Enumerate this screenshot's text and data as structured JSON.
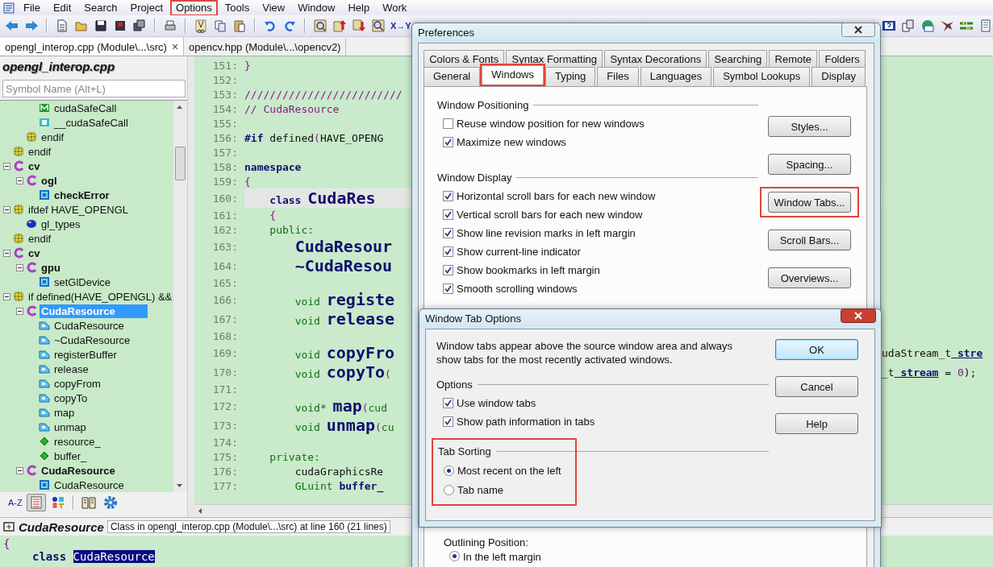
{
  "menu_bar": {
    "items": [
      {
        "label": "File",
        "highlighted": false
      },
      {
        "label": "Edit",
        "highlighted": false
      },
      {
        "label": "Search",
        "highlighted": false
      },
      {
        "label": "Project",
        "highlighted": false
      },
      {
        "label": "Options",
        "highlighted": true
      },
      {
        "label": "Tools",
        "highlighted": false
      },
      {
        "label": "View",
        "highlighted": false
      },
      {
        "label": "Window",
        "highlighted": false
      },
      {
        "label": "Help",
        "highlighted": false
      },
      {
        "label": "Work",
        "highlighted": false
      }
    ]
  },
  "toolbar": {
    "replace_label": "X→Y"
  },
  "file_tabs": [
    {
      "label": "opengl_interop.cpp (Module\\...\\src)",
      "selected": true,
      "close": "×"
    },
    {
      "label": "opencv.hpp (Module\\...\\opencv2)",
      "selected": false
    }
  ],
  "symbol_panel": {
    "title": "opengl_interop.cpp",
    "search": {
      "placeholder": "Symbol Name (Alt+L)"
    },
    "tree": [
      {
        "children": [
          {
            "children": [
              {
                "label": "cudaSafeCall",
                "kind": "macro",
                "bold": false,
                "selected": false
              },
              {
                "label": "__cudaSafeCall",
                "kind": "function-def",
                "bold": false,
                "selected": false
              }
            ]
          },
          {
            "label": "endif",
            "kind": "preprocessor",
            "bold": false,
            "selected": false
          }
        ]
      },
      {
        "label": "endif",
        "kind": "preprocessor",
        "bold": false,
        "selected": false
      },
      {
        "label": "cv",
        "kind": "namespace",
        "bold": true,
        "selected": false,
        "expanded": true,
        "children": [
          {
            "label": "ogl",
            "kind": "namespace",
            "bold": true,
            "selected": false,
            "expanded": true,
            "children": [
              {
                "label": "checkError",
                "kind": "function",
                "bold": true,
                "selected": false
              }
            ]
          }
        ]
      },
      {
        "label": "ifdef HAVE_OPENGL",
        "kind": "preprocessor",
        "bold": false,
        "selected": false,
        "expanded": true,
        "children": [
          {
            "label": "gl_types",
            "kind": "typedef",
            "bold": false,
            "selected": false
          }
        ]
      },
      {
        "label": "endif",
        "kind": "preprocessor",
        "bold": false,
        "selected": false
      },
      {
        "label": "cv",
        "kind": "namespace",
        "bold": true,
        "selected": false,
        "expanded": true,
        "children": [
          {
            "label": "gpu",
            "kind": "namespace",
            "bold": true,
            "selected": false,
            "expanded": true,
            "children": [
              {
                "label": "setGlDevice",
                "kind": "function",
                "bold": false,
                "selected": false
              }
            ]
          }
        ]
      },
      {
        "label": "if defined(HAVE_OPENGL) &&",
        "kind": "preprocessor",
        "bold": false,
        "selected": false,
        "expanded": true,
        "children": [
          {
            "label": "CudaResource",
            "kind": "namespace",
            "bold": true,
            "selected": true,
            "expanded": true,
            "children": [
              {
                "label": "CudaResource",
                "kind": "method",
                "bold": false,
                "selected": false
              },
              {
                "label": "~CudaResource",
                "kind": "method",
                "bold": false,
                "selected": false
              },
              {
                "label": "registerBuffer",
                "kind": "method",
                "bold": false,
                "selected": false
              },
              {
                "label": "release",
                "kind": "method",
                "bold": false,
                "selected": false
              },
              {
                "label": "copyFrom",
                "kind": "method",
                "bold": false,
                "selected": false
              },
              {
                "label": "copyTo",
                "kind": "method",
                "bold": false,
                "selected": false
              },
              {
                "label": "map",
                "kind": "method",
                "bold": false,
                "selected": false
              },
              {
                "label": "unmap",
                "kind": "method",
                "bold": false,
                "selected": false
              },
              {
                "label": "resource_",
                "kind": "field",
                "bold": false,
                "selected": false
              },
              {
                "label": "buffer_",
                "kind": "field",
                "bold": false,
                "selected": false
              }
            ]
          },
          {
            "label": "CudaResource",
            "kind": "namespace",
            "bold": true,
            "selected": false,
            "expanded": true,
            "children": [
              {
                "label": "CudaResource",
                "kind": "function",
                "bold": false,
                "selected": false
              }
            ]
          }
        ]
      }
    ],
    "view_buttons": [
      {
        "kind": "alpha",
        "label": "A-Z",
        "selected": false
      },
      {
        "kind": "outline",
        "selected": true
      },
      {
        "kind": "symbol-types",
        "selected": false
      }
    ]
  },
  "editor": {
    "lines": [
      {
        "number": "151:",
        "current": false,
        "tokens": [
          {
            "text": "}",
            "kind": "paren"
          }
        ]
      },
      {
        "number": "152:",
        "current": false
      },
      {
        "number": "153:",
        "current": false,
        "tokens": [
          {
            "text": "/////////////////////////",
            "kind": "comment"
          }
        ]
      },
      {
        "number": "154:",
        "current": false,
        "tokens": [
          {
            "text": "// CudaResource",
            "kind": "comment"
          }
        ]
      },
      {
        "number": "155:",
        "current": false
      },
      {
        "number": "156:",
        "current": false,
        "tokens": [
          {
            "text": "#if",
            "kind": "kw"
          },
          {
            "text": " defined",
            "kind": "plain"
          },
          {
            "text": "(",
            "kind": "paren"
          },
          {
            "text": "HAVE_OPENG",
            "kind": "plain"
          }
        ]
      },
      {
        "number": "157:",
        "current": false
      },
      {
        "number": "158:",
        "current": false,
        "tokens": [
          {
            "text": "namespace",
            "kind": "kw"
          }
        ]
      },
      {
        "number": "159:",
        "current": false,
        "tokens": [
          {
            "text": "{",
            "kind": "paren"
          }
        ]
      },
      {
        "number": "160:",
        "current": true,
        "tokens": [
          {
            "text": "    class",
            "kind": "kw"
          },
          {
            "text": " CudaRes",
            "kind": "name"
          }
        ]
      },
      {
        "number": "161:",
        "current": false,
        "tokens": [
          {
            "text": "    {",
            "kind": "paren"
          }
        ]
      },
      {
        "number": "162:",
        "current": false,
        "tokens": [
          {
            "text": "    public:",
            "kind": "type"
          }
        ]
      },
      {
        "number": "163:",
        "current": false,
        "tokens": [
          {
            "text": "        CudaResour",
            "kind": "name"
          }
        ]
      },
      {
        "number": "164:",
        "current": false,
        "tokens": [
          {
            "text": "        ~CudaResou",
            "kind": "name"
          }
        ]
      },
      {
        "number": "165:",
        "current": false
      },
      {
        "number": "166:",
        "current": false,
        "tokens": [
          {
            "text": "        void",
            "kind": "type"
          },
          {
            "text": " registe",
            "kind": "name"
          }
        ]
      },
      {
        "number": "167:",
        "current": false,
        "tokens": [
          {
            "text": "        void",
            "kind": "type"
          },
          {
            "text": " release",
            "kind": "name"
          }
        ]
      },
      {
        "number": "168:",
        "current": false
      },
      {
        "number": "169:",
        "current": false,
        "tokens": [
          {
            "text": "        void",
            "kind": "type"
          },
          {
            "text": " copyFro",
            "kind": "name"
          }
        ],
        "tail": [
          {
            "text": "udaStream_t",
            "kind": "plain"
          },
          {
            "text": " stre",
            "kind": "param"
          }
        ]
      },
      {
        "number": "170:",
        "current": false,
        "tokens": [
          {
            "text": "        void",
            "kind": "type"
          },
          {
            "text": " copyTo",
            "kind": "name"
          },
          {
            "text": "(",
            "kind": "paren"
          }
        ],
        "tail": [
          {
            "text": "_t",
            "kind": "plain"
          },
          {
            "text": " stream",
            "kind": "param"
          },
          {
            "text": " = ",
            "kind": "plain"
          },
          {
            "text": "0",
            "kind": "paren"
          },
          {
            "text": ");",
            "kind": "plain"
          }
        ]
      },
      {
        "number": "171:",
        "current": false
      },
      {
        "number": "172:",
        "current": false,
        "tokens": [
          {
            "text": "        void*",
            "kind": "type"
          },
          {
            "text": " map",
            "kind": "name"
          },
          {
            "text": "(",
            "kind": "paren"
          },
          {
            "text": "cud",
            "kind": "type"
          }
        ]
      },
      {
        "number": "173:",
        "current": false,
        "tokens": [
          {
            "text": "        void",
            "kind": "type"
          },
          {
            "text": " unmap",
            "kind": "name"
          },
          {
            "text": "(",
            "kind": "paren"
          },
          {
            "text": "cu",
            "kind": "type"
          }
        ]
      },
      {
        "number": "174:",
        "current": false
      },
      {
        "number": "175:",
        "current": false,
        "tokens": [
          {
            "text": "    private:",
            "kind": "type"
          }
        ]
      },
      {
        "number": "176:",
        "current": false,
        "tokens": [
          {
            "text": "        cudaGraphicsRe",
            "kind": "plain"
          }
        ]
      },
      {
        "number": "177:",
        "current": false,
        "tokens": [
          {
            "text": "        GLuint",
            "kind": "type"
          },
          {
            "text": " buffer_",
            "kind": "member"
          }
        ]
      }
    ]
  },
  "context_bar": {
    "symbol": "CudaResource",
    "description": "Class in opengl_interop.cpp (Module\\...\\src) at line 160 (21 lines)"
  },
  "context_code": {
    "brace": "{",
    "keyword": "class",
    "name": "CudaResource"
  },
  "preferences": {
    "title": "Preferences",
    "tab_rows": [
      [
        {
          "label": "Colors & Fonts",
          "selected": false,
          "highlighted": false
        },
        {
          "label": "Syntax Formatting",
          "selected": false,
          "highlighted": false
        },
        {
          "label": "Syntax Decorations",
          "selected": false,
          "highlighted": false
        },
        {
          "label": "Searching",
          "selected": false,
          "highlighted": false
        },
        {
          "label": "Remote",
          "selected": false,
          "highlighted": false
        },
        {
          "label": "Folders",
          "selected": false,
          "highlighted": false
        }
      ],
      [
        {
          "label": "General",
          "selected": false,
          "highlighted": false
        },
        {
          "label": "Windows",
          "selected": true,
          "highlighted": true
        },
        {
          "label": "Typing",
          "selected": false,
          "highlighted": false
        },
        {
          "label": "Files",
          "selected": false,
          "highlighted": false
        },
        {
          "label": "Languages",
          "selected": false,
          "highlighted": false
        },
        {
          "label": "Symbol Lookups",
          "selected": false,
          "highlighted": false
        },
        {
          "label": "Display",
          "selected": false,
          "highlighted": false
        }
      ]
    ],
    "groups": [
      {
        "title": "Window Positioning",
        "options": [
          {
            "label": "Reuse window position for new windows",
            "checked": false
          },
          {
            "label": "Maximize new windows",
            "checked": true
          }
        ]
      },
      {
        "title": "Window Display",
        "options": [
          {
            "label": "Horizontal scroll bars for each new window",
            "checked": true
          },
          {
            "label": "Vertical scroll bars for each new window",
            "checked": true
          },
          {
            "label": "Show line revision marks in left margin",
            "checked": true
          },
          {
            "label": "Show current-line indicator",
            "checked": true
          },
          {
            "label": "Show bookmarks in left margin",
            "checked": true
          },
          {
            "label": "Smooth scrolling windows",
            "checked": true
          }
        ]
      }
    ],
    "buttons": [
      {
        "label": "Styles...",
        "highlighted": false
      },
      {
        "label": "Spacing...",
        "highlighted": false
      },
      {
        "label": "Window Tabs...",
        "highlighted": true
      },
      {
        "label": "Scroll Bars...",
        "highlighted": false
      },
      {
        "label": "Overviews...",
        "highlighted": false
      }
    ],
    "outlining": {
      "title": "Outlining Position:",
      "options": [
        {
          "label": "In the left margin",
          "selected": true
        }
      ]
    }
  },
  "window_tab_options": {
    "title": "Window Tab Options",
    "description": "Window tabs appear above the source window area and always show tabs for the most recently activated windows.",
    "options_title": "Options",
    "options": [
      {
        "label": "Use window tabs",
        "checked": true
      },
      {
        "label": "Show path information in tabs",
        "checked": true
      }
    ],
    "sorting": {
      "title": "Tab Sorting",
      "highlighted": true,
      "choices": [
        {
          "label": "Most recent on the left",
          "selected": true
        },
        {
          "label": "Tab name",
          "selected": false
        }
      ]
    },
    "buttons": [
      {
        "label": "OK",
        "default": true
      },
      {
        "label": "Cancel",
        "default": false
      },
      {
        "label": "Help",
        "default": false
      }
    ]
  }
}
